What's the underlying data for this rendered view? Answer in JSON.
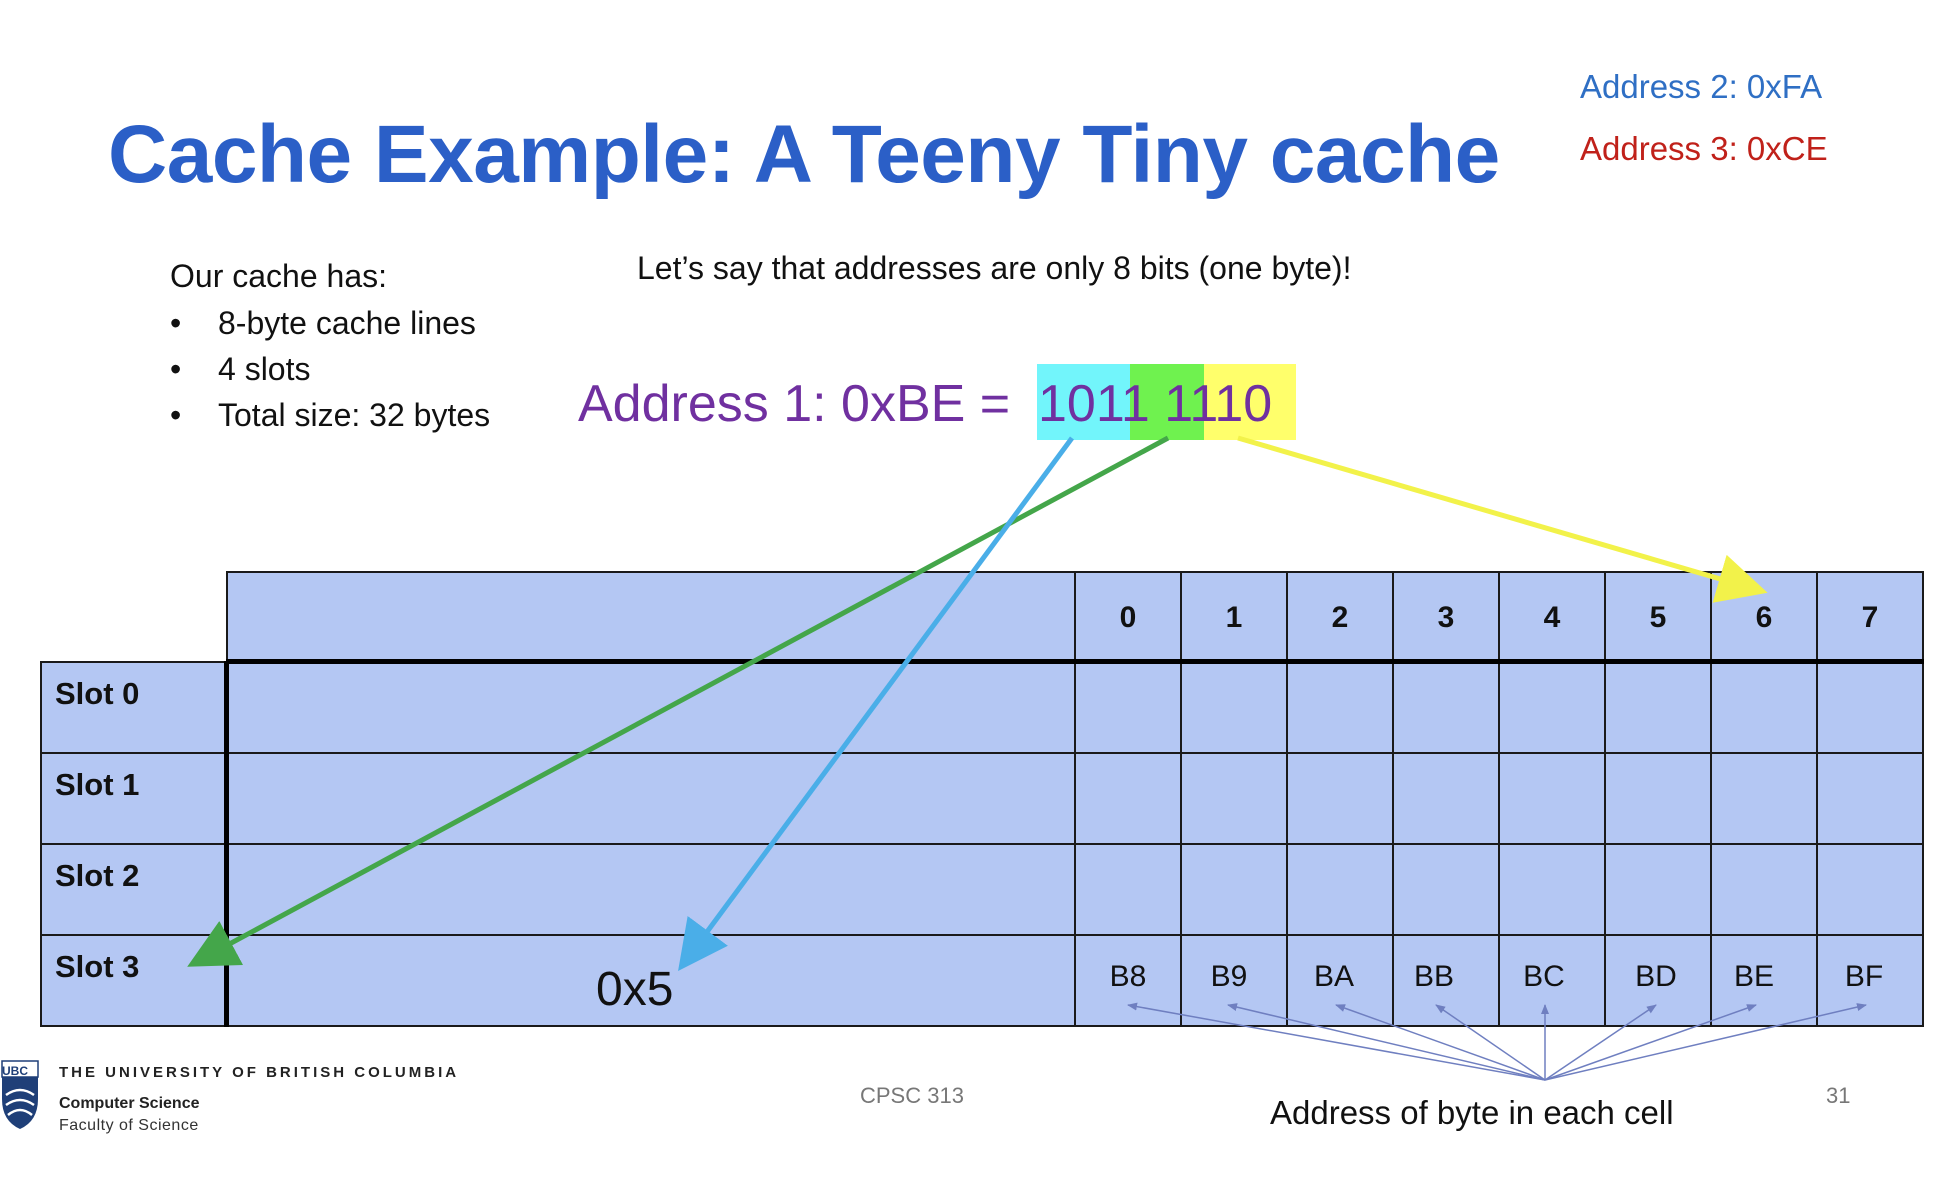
{
  "slide": {
    "title": "Cache Example: A Teeny Tiny cache",
    "address2": "Address 2: 0xFA",
    "address3": "Address 3: 0xCE",
    "cache_intro": "Our cache has:",
    "cache_props": [
      "8-byte cache lines",
      "4 slots",
      "Total size: 32 bytes"
    ],
    "address_note": "Let’s say that addresses are only 8 bits (one byte)!",
    "address1_label": "Address 1: 0xBE =",
    "address1_bits": "1011 1110"
  },
  "table": {
    "columns": [
      "0",
      "1",
      "2",
      "3",
      "4",
      "5",
      "6",
      "7"
    ],
    "slots": [
      "Slot 0",
      "Slot 1",
      "Slot 2",
      "Slot 3"
    ],
    "slot3_tag": "0x5",
    "slot3_bytes": [
      "B8",
      "B9",
      "BA",
      "BB",
      "BC",
      "BD",
      "BE",
      "BF"
    ],
    "byte_caption": "Address of byte in each cell"
  },
  "footer": {
    "university": "THE UNIVERSITY OF BRITISH COLUMBIA",
    "logo_text": "UBC",
    "department": "Computer Science",
    "faculty": "Faculty of Science",
    "course": "CPSC 313",
    "page": "31"
  },
  "colors": {
    "title": "#2b5fc7",
    "address2": "#2f6fc4",
    "address3": "#c0211a",
    "address1": "#7030a0",
    "tag_highlight": "#72f5fb",
    "index_highlight": "#6ff24f",
    "offset_highlight": "#ffff6b",
    "table_fill": "#b4c7f3",
    "arrow_tag": "#4aaee8",
    "arrow_index": "#44a64a",
    "arrow_offset": "#f2f24a"
  }
}
